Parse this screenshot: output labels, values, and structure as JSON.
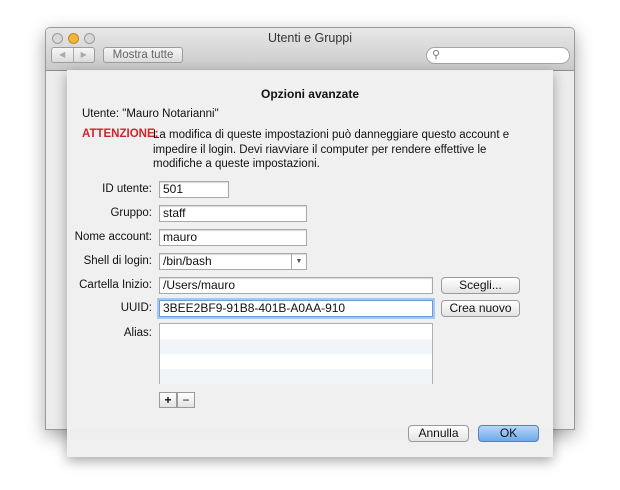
{
  "window": {
    "title": "Utenti e Gruppi",
    "back_icon": "◀",
    "forward_icon": "▶",
    "show_all": "Mostra tutte",
    "search_placeholder": ""
  },
  "sheet": {
    "title": "Opzioni avanzate",
    "user": "Utente: \"Mauro Notarianni\"",
    "warning_label": "ATTENZIONE:",
    "warning_lines": [
      "La modifica di queste impostazioni può danneggiare questo account e",
      "impedire il login. Devi riavviare il computer per rendere effettive le",
      "modifiche a queste impostazioni."
    ],
    "warning_color": "#d0242a",
    "fields": {
      "user_id": {
        "label": "ID utente:",
        "value": "501"
      },
      "group": {
        "label": "Gruppo:",
        "value": "staff"
      },
      "account_name": {
        "label": "Nome account:",
        "value": "mauro"
      },
      "login_shell": {
        "label": "Shell di login:",
        "value": "/bin/bash"
      },
      "home_folder": {
        "label": "Cartella Inizio:",
        "value": "/Users/mauro"
      },
      "uuid": {
        "label": "UUID:",
        "value": "3BEE2BF9-91B8-401B-A0AA-910"
      },
      "alias": {
        "label": "Alias:"
      }
    },
    "choose": "Scegli...",
    "create_new": "Crea nuovo",
    "add": "+",
    "remove": "−",
    "cancel": "Annulla",
    "ok": "OK"
  }
}
